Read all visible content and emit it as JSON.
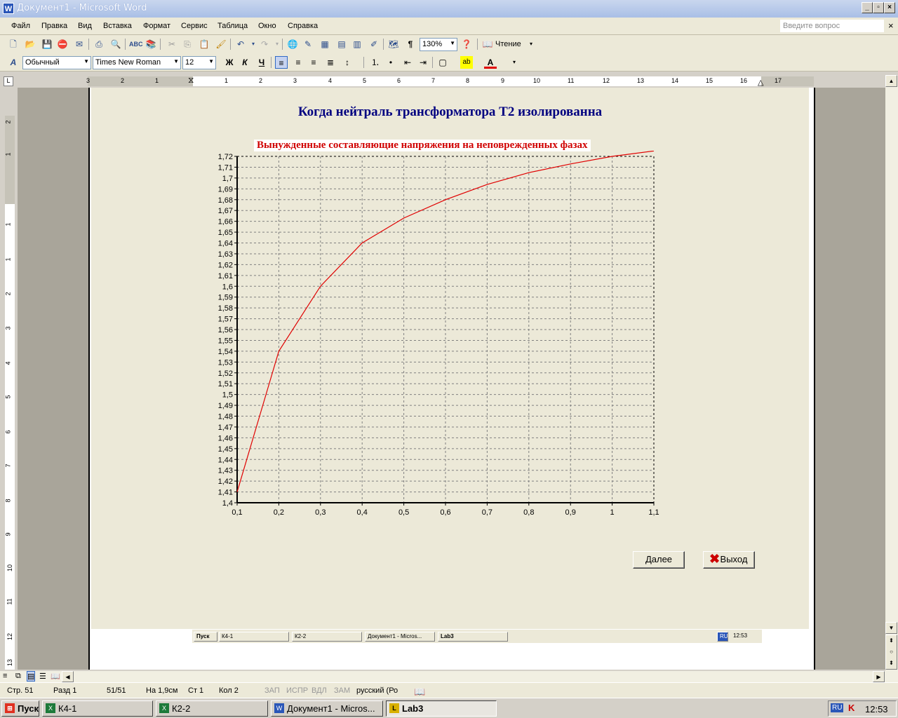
{
  "window": {
    "title": "Документ1 - Microsoft Word",
    "app_icon": "W",
    "minimize": "_",
    "restore": "▫",
    "close": "×"
  },
  "menu": {
    "items": [
      "Файл",
      "Правка",
      "Вид",
      "Вставка",
      "Формат",
      "Сервис",
      "Таблица",
      "Окно",
      "Справка"
    ],
    "ask_placeholder": "Введите вопрос",
    "close_doc": "×"
  },
  "toolbar": {
    "zoom": "130%",
    "reading_label": "Чтение",
    "style": "Обычный",
    "font": "Times New Roman",
    "size": "12",
    "bold": "Ж",
    "italic": "К",
    "underline": "Ч"
  },
  "ruler": {
    "h_labels": [
      "3",
      "2",
      "1",
      "1",
      "2",
      "3",
      "4",
      "5",
      "6",
      "7",
      "8",
      "9",
      "10",
      "11",
      "12",
      "13",
      "14",
      "15",
      "16",
      "17"
    ],
    "v_labels": [
      "2",
      "1",
      "1",
      "1",
      "2",
      "3",
      "4",
      "5",
      "6",
      "7",
      "8",
      "9",
      "10",
      "11",
      "12",
      "13"
    ]
  },
  "app": {
    "heading": "Когда нейтраль трансформатора Т2 изолированна",
    "next_button": "Далее",
    "exit_button": "Выход",
    "exit_icon_color": "#cc0000"
  },
  "chart_data": {
    "type": "line",
    "title": "Вынужденные составляющие напряжения на неповрежденных фазах",
    "xlabel": "",
    "ylabel": "",
    "x_tick_labels": [
      "0,1",
      "0,2",
      "0,3",
      "0,4",
      "0,5",
      "0,6",
      "0,7",
      "0,8",
      "0,9",
      "1",
      "1,1"
    ],
    "y_tick_labels": [
      "1,4",
      "1,41",
      "1,42",
      "1,43",
      "1,44",
      "1,45",
      "1,46",
      "1,47",
      "1,48",
      "1,49",
      "1,5",
      "1,51",
      "1,52",
      "1,53",
      "1,54",
      "1,55",
      "1,56",
      "1,57",
      "1,58",
      "1,59",
      "1,6",
      "1,61",
      "1,62",
      "1,63",
      "1,64",
      "1,65",
      "1,66",
      "1,67",
      "1,68",
      "1,69",
      "1,7",
      "1,71",
      "1,72"
    ],
    "xlim": [
      0.1,
      1.1
    ],
    "ylim": [
      1.4,
      1.72
    ],
    "grid": true,
    "line_color": "#e00000",
    "series": [
      {
        "x": [
          0.1,
          0.2,
          0.3,
          0.4,
          0.5,
          0.6,
          0.7,
          0.8,
          0.9,
          1.0,
          1.1
        ],
        "y": [
          1.41,
          1.54,
          1.6,
          1.64,
          1.663,
          1.68,
          1.694,
          1.705,
          1.713,
          1.72,
          1.725
        ]
      }
    ]
  },
  "inner_taskbar": {
    "start": "Пуск",
    "items": [
      "К4-1",
      "К2-2",
      "Документ1 - Micros...",
      "Lab3"
    ],
    "lang": "RU",
    "clock": "12:53"
  },
  "status": {
    "page": "Стр.  51",
    "section": "Разд  1",
    "pages": "51/51",
    "at": "На  1,9см",
    "line": "Ст  1",
    "col": "Кол  2",
    "rec": "ЗАП",
    "trk": "ИСПР",
    "ext": "ВДЛ",
    "ovr": "ЗАМ",
    "lang": "русский (Ро"
  },
  "taskbar": {
    "start": "Пуск",
    "items": [
      "К4-1",
      "К2-2",
      "Документ1 - Micros...",
      "Lab3"
    ],
    "lang": "RU",
    "clock": "12:53"
  }
}
